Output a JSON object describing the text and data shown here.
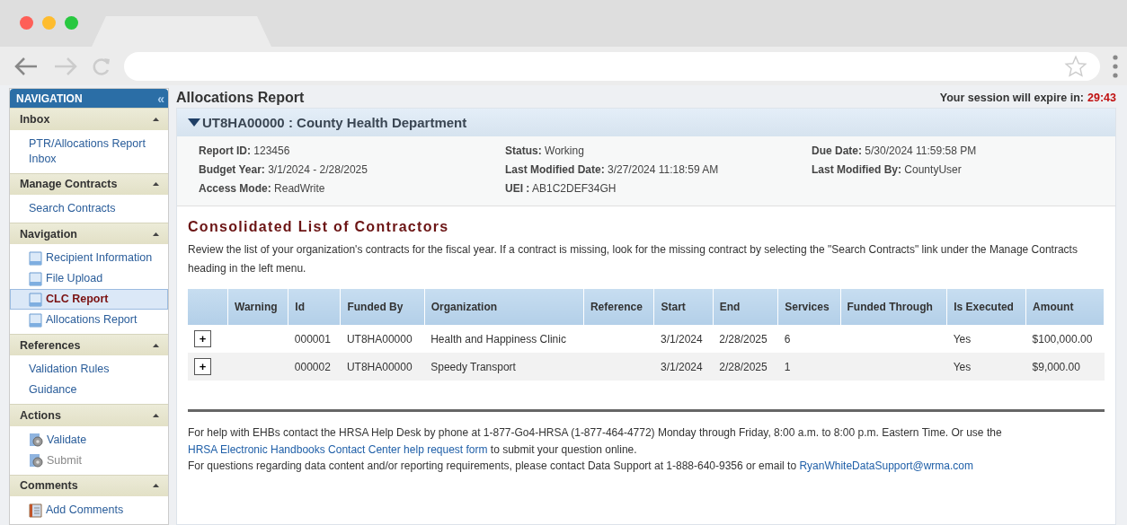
{
  "sidebar": {
    "title": "NAVIGATION",
    "collapse_icon": "«",
    "sections": [
      {
        "title": "Inbox",
        "expanded": true,
        "items": [
          {
            "label": "PTR/Allocations Report Inbox",
            "kind": "link",
            "selected": false,
            "disabled": false
          }
        ]
      },
      {
        "title": "Manage Contracts",
        "expanded": true,
        "items": [
          {
            "label": "Search Contracts",
            "kind": "link",
            "selected": false,
            "disabled": false
          }
        ]
      },
      {
        "title": "Navigation",
        "expanded": true,
        "items": [
          {
            "label": "Recipient Information",
            "kind": "page",
            "selected": false,
            "disabled": false
          },
          {
            "label": "File Upload",
            "kind": "page",
            "selected": false,
            "disabled": false
          },
          {
            "label": "CLC Report",
            "kind": "page",
            "selected": true,
            "disabled": false
          },
          {
            "label": "Allocations Report",
            "kind": "page",
            "selected": false,
            "disabled": false
          }
        ]
      },
      {
        "title": "References",
        "expanded": true,
        "items": [
          {
            "label": "Validation Rules",
            "kind": "link",
            "selected": false,
            "disabled": false
          },
          {
            "label": "Guidance",
            "kind": "link",
            "selected": false,
            "disabled": false
          }
        ]
      },
      {
        "title": "Actions",
        "expanded": true,
        "items": [
          {
            "label": "Validate",
            "kind": "gear",
            "selected": false,
            "disabled": false
          },
          {
            "label": "Submit",
            "kind": "gear",
            "selected": false,
            "disabled": true
          }
        ]
      },
      {
        "title": "Comments",
        "expanded": true,
        "items": [
          {
            "label": "Add Comments",
            "kind": "note",
            "selected": false,
            "disabled": false
          }
        ]
      }
    ]
  },
  "page_title": "Allocations Report",
  "session": {
    "label": "Your session will expire in:",
    "time": "29:43"
  },
  "panel": {
    "title": "UT8HA00000 : County Health Department",
    "expanded": true,
    "fields": [
      {
        "label": "Report ID:",
        "value": "123456"
      },
      {
        "label": "Status:",
        "value": "Working"
      },
      {
        "label": "Due Date:",
        "value": "5/30/2024 11:59:58 PM"
      },
      {
        "label": "Budget Year:",
        "value": "3/1/2024 - 2/28/2025"
      },
      {
        "label": "Last Modified Date:",
        "value": "3/27/2024 11:18:59 AM"
      },
      {
        "label": "Last Modified By:",
        "value": "CountyUser"
      },
      {
        "label": "Access Mode:",
        "value": "ReadWrite"
      },
      {
        "label": "UEI :",
        "value": "AB1C2DEF34GH"
      }
    ]
  },
  "section_title": "Consolidated List of Contractors",
  "intro": "Review the list of your organization's contracts for the fiscal year. If a contract is missing, look for the missing contract by selecting the \"Search Contracts\" link under the Manage Contracts heading in the left menu.",
  "table": {
    "columns": [
      "Warning",
      "Id",
      "Funded By",
      "Organization",
      "Reference",
      "Start",
      "End",
      "Services",
      "Funded Through",
      "Is Executed",
      "Amount"
    ],
    "rows": [
      {
        "expand": "+",
        "cells": [
          "",
          "000001",
          "UT8HA00000",
          "Health and Happiness Clinic",
          "",
          "3/1/2024",
          "2/28/2025",
          "6",
          "",
          "Yes",
          "$100,000.00"
        ]
      },
      {
        "expand": "+",
        "cells": [
          "",
          "000002",
          "UT8HA00000",
          "Speedy Transport",
          "",
          "3/1/2024",
          "2/28/2025",
          "1",
          "",
          "Yes",
          "$9,000.00"
        ]
      }
    ]
  },
  "help": [
    [
      {
        "kind": "text",
        "text": "For help with EHBs contact the HRSA Help Desk by phone at 1-877-Go4-HRSA (1-877-464-4772) Monday through Friday, 8:00 a.m. to 8:00 p.m. Eastern Time. Or use the "
      },
      {
        "kind": "link",
        "text": "HRSA Electronic Handbooks Contact Center help request form"
      },
      {
        "kind": "text",
        "text": " to submit your question online."
      }
    ],
    [
      {
        "kind": "text",
        "text": "For questions regarding data content and/or reporting requirements, please contact Data Support at 1-888-640-9356 or email to "
      },
      {
        "kind": "link",
        "text": "RyanWhiteDataSupport@wrma.com"
      }
    ]
  ]
}
